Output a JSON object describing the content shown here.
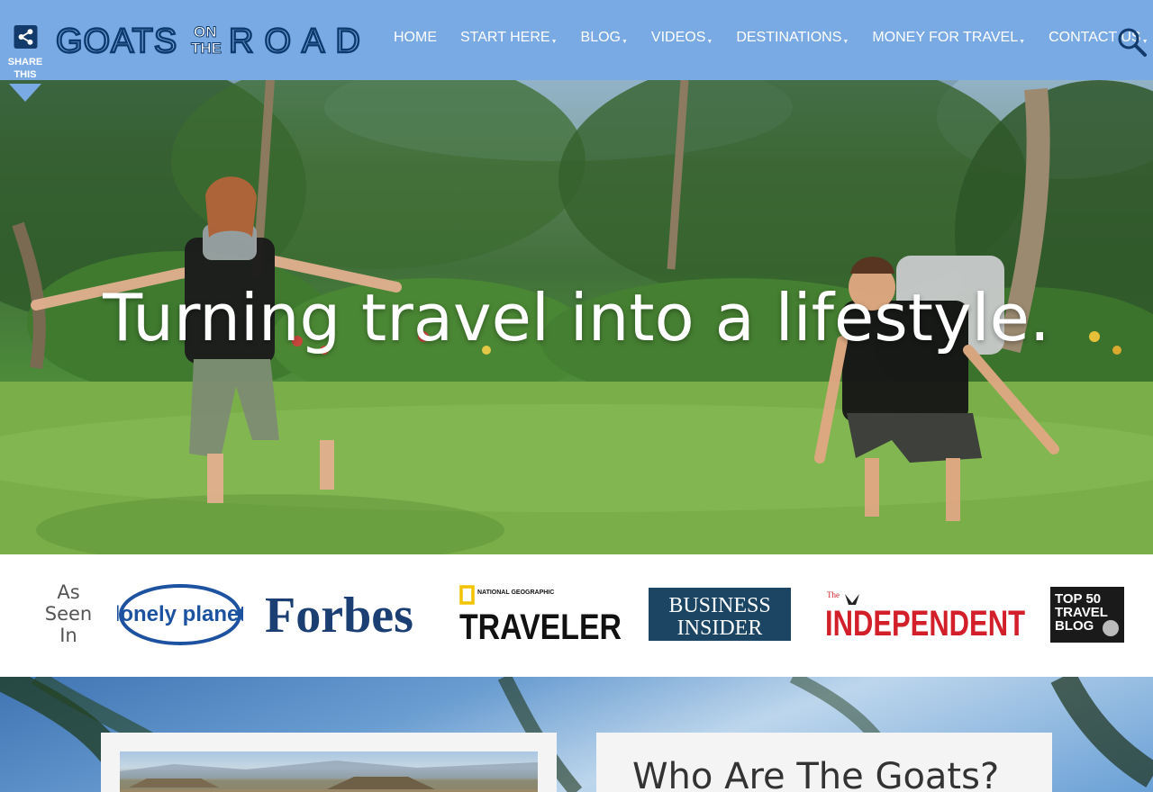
{
  "header": {
    "share": {
      "line1": "SHARE",
      "line2": "THIS",
      "icon": "share-icon"
    },
    "logo": {
      "word1": "GOATS",
      "small_top": "ON",
      "small_bottom": "THE",
      "word2": "ROAD"
    },
    "nav": [
      {
        "label": "HOME",
        "has_dropdown": false
      },
      {
        "label": "START HERE",
        "has_dropdown": true
      },
      {
        "label": "BLOG",
        "has_dropdown": true
      },
      {
        "label": "VIDEOS",
        "has_dropdown": true
      },
      {
        "label": "DESTINATIONS",
        "has_dropdown": true
      },
      {
        "label": "MONEY FOR TRAVEL",
        "has_dropdown": true
      },
      {
        "label": "CONTACT US",
        "has_dropdown": true
      }
    ],
    "search_icon": "search-icon",
    "colors": {
      "bar": "#7aaae4",
      "text": "#ffffff"
    }
  },
  "hero": {
    "headline": "Turning travel into a lifestyle."
  },
  "press": {
    "as_seen": [
      "As",
      "Seen",
      "In"
    ],
    "logos": {
      "lonely_planet": "lonely planet",
      "forbes": "Forbes",
      "natgeo_small": "NATIONAL GEOGRAPHIC",
      "natgeo_big": "TRAVELER",
      "business_insider_1": "BUSINESS",
      "business_insider_2": "INSIDER",
      "independent_small": "The",
      "independent": "INDEPENDENT",
      "top50_1": "TOP 50",
      "top50_2": "TRAVEL",
      "top50_3": "BLOG"
    }
  },
  "bottom": {
    "card_title": "Who Are The Goats?"
  }
}
